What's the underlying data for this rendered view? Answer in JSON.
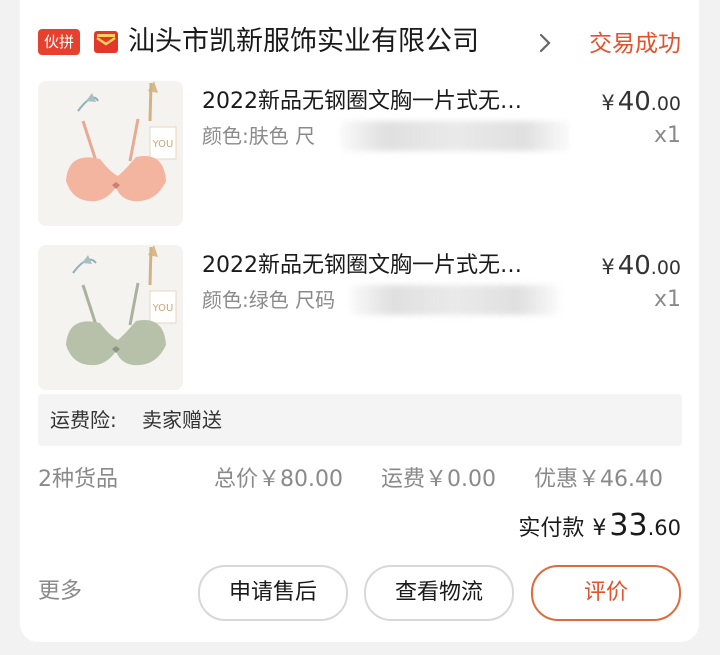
{
  "header": {
    "tag": "伙拼",
    "shop_name": "汕头市凯新服饰实业有限公司",
    "status": "交易成功"
  },
  "items": [
    {
      "title": "2022新品无钢圈文胸一片式无…",
      "spec": "颜色:肤色 尺",
      "price_currency": "¥",
      "price_int": "40",
      "price_dec": ".00",
      "qty": "x1",
      "thumb_color": "#f6b9a3"
    },
    {
      "title": "2022新品无钢圈文胸一片式无…",
      "spec": "颜色:绿色 尺码",
      "price_currency": "¥",
      "price_int": "40",
      "price_dec": ".00",
      "qty": "x1",
      "thumb_color": "#b5bfa8"
    }
  ],
  "insurance": {
    "label": "运费险:",
    "value": "卖家赠送"
  },
  "summary": {
    "count": "2种货品",
    "total": "总价￥80.00",
    "shipping": "运费￥0.00",
    "discount": "优惠￥46.40"
  },
  "paid": {
    "label": "实付款",
    "currency": "¥",
    "int": "33",
    "dec": ".60"
  },
  "actions": {
    "more": "更多",
    "after_sale": "申请售后",
    "logistics": "查看物流",
    "review": "评价"
  },
  "colors": {
    "accent": "#e4512a",
    "tag_bg": "#e8402e"
  }
}
